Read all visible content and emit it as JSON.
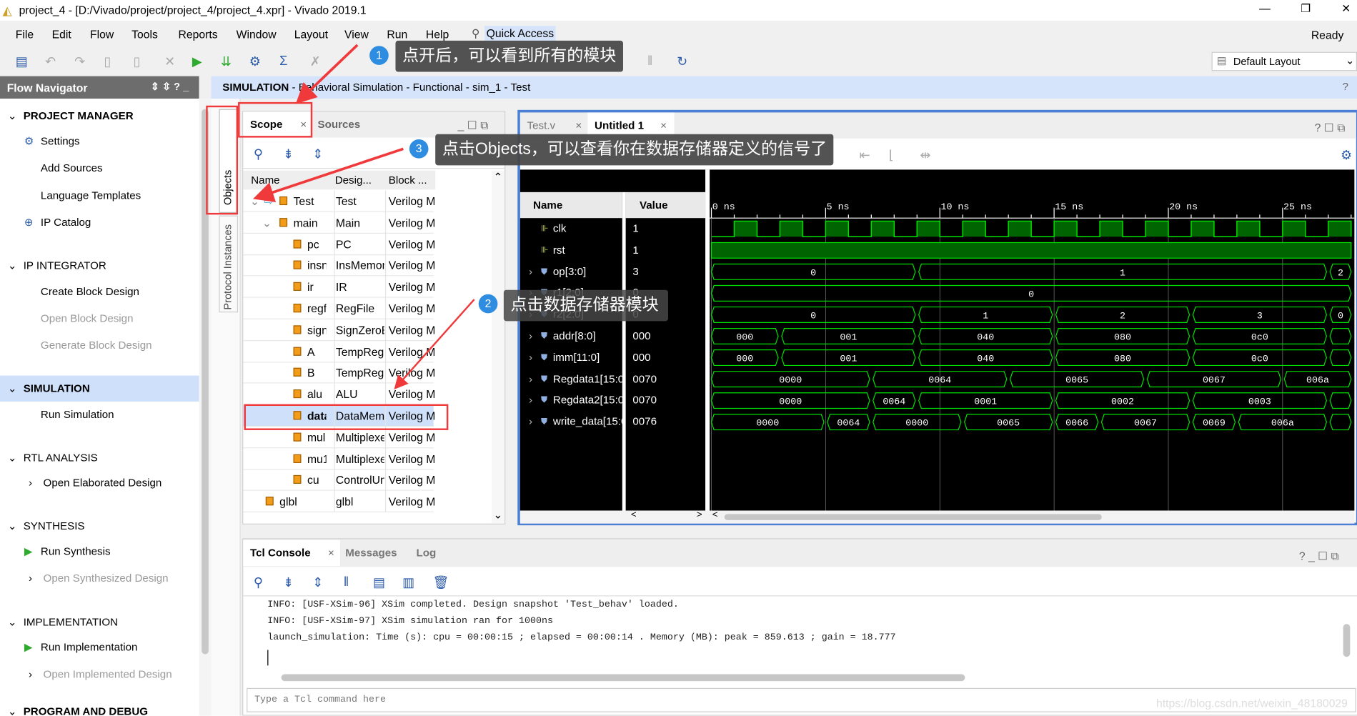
{
  "window": {
    "title": "project_4 - [D:/Vivado/project/project_4/project_4.xpr] - Vivado 2019.1",
    "status": "Ready",
    "controls": [
      "—",
      "❐",
      "✕"
    ]
  },
  "menu": [
    "File",
    "Edit",
    "Flow",
    "Tools",
    "Reports",
    "Window",
    "Layout",
    "View",
    "Run",
    "Help"
  ],
  "quick_access": "Quick Access",
  "layout_select": "Default Layout",
  "flow_navigator": {
    "title": "Flow Navigator",
    "items": [
      {
        "label": "PROJECT MANAGER",
        "type": "section",
        "bold": true
      },
      {
        "label": "Settings",
        "icon": "gear-icon"
      },
      {
        "label": "Add Sources"
      },
      {
        "label": "Language Templates"
      },
      {
        "label": "IP Catalog",
        "icon": "ip-icon"
      },
      {
        "label": "IP INTEGRATOR",
        "type": "section"
      },
      {
        "label": "Create Block Design"
      },
      {
        "label": "Open Block Design",
        "disabled": true
      },
      {
        "label": "Generate Block Design",
        "disabled": true
      },
      {
        "label": "SIMULATION",
        "type": "section",
        "bold": true,
        "selected": true
      },
      {
        "label": "Run Simulation"
      },
      {
        "label": "RTL ANALYSIS",
        "type": "section"
      },
      {
        "label": "Open Elaborated Design",
        "expand": true
      },
      {
        "label": "SYNTHESIS",
        "type": "section"
      },
      {
        "label": "Run Synthesis",
        "icon": "run-icon"
      },
      {
        "label": "Open Synthesized Design",
        "expand": true,
        "disabled": true
      },
      {
        "label": "IMPLEMENTATION",
        "type": "section"
      },
      {
        "label": "Run Implementation",
        "icon": "run-icon"
      },
      {
        "label": "Open Implemented Design",
        "expand": true,
        "disabled": true
      },
      {
        "label": "PROGRAM AND DEBUG",
        "type": "section",
        "bold": true
      }
    ]
  },
  "side_tabs": [
    "Objects",
    "Protocol Instances"
  ],
  "sim_header": {
    "bold": "SIMULATION",
    "rest": " - Behavioral Simulation - Functional - sim_1 - Test"
  },
  "scope": {
    "tabs": [
      "Scope",
      "Sources"
    ],
    "columns": [
      "Name",
      "Desig...",
      "Block ..."
    ],
    "rows": [
      {
        "name": "Test",
        "design": "Test",
        "block": "Verilog Mc",
        "level": 0,
        "expanded": true,
        "top": true
      },
      {
        "name": "main",
        "design": "Main",
        "block": "Verilog Mc",
        "level": 1,
        "expanded": true
      },
      {
        "name": "pc",
        "design": "PC",
        "block": "Verilog Mc",
        "level": 2
      },
      {
        "name": "insn",
        "design": "InsMemory",
        "block": "Verilog Mc",
        "level": 2
      },
      {
        "name": "ir",
        "design": "IR",
        "block": "Verilog Mc",
        "level": 2
      },
      {
        "name": "regfile",
        "design": "RegFile",
        "block": "Verilog Mc",
        "level": 2
      },
      {
        "name": "sign",
        "design": "SignZeroExtend",
        "block": "Verilog Mc",
        "level": 2
      },
      {
        "name": "A",
        "design": "TempReg",
        "block": "Verilog Mc",
        "level": 2
      },
      {
        "name": "B",
        "design": "TempReg",
        "block": "Verilog Mc",
        "level": 2
      },
      {
        "name": "alu",
        "design": "ALU",
        "block": "Verilog Mc",
        "level": 2
      },
      {
        "name": "data",
        "design": "DataMemory",
        "block": "Verilog Mc",
        "level": 2,
        "selected": true
      },
      {
        "name": "mul",
        "design": "Multiplexer",
        "block": "Verilog Mc",
        "level": 2
      },
      {
        "name": "mu1",
        "design": "Multiplexer",
        "block": "Verilog Mc",
        "level": 2
      },
      {
        "name": "cu",
        "design": "ControlUnit",
        "block": "Verilog Mc",
        "level": 2
      },
      {
        "name": "glbl",
        "design": "glbl",
        "block": "Verilog Mc",
        "level": 0
      }
    ]
  },
  "wave": {
    "tabs": [
      "Test.v",
      "Untitled 1"
    ],
    "columns": [
      "Name",
      "Value"
    ],
    "time_unit": "ns",
    "ticks": [
      0,
      5,
      10,
      15,
      20,
      25
    ],
    "view_range_ns": [
      0,
      28
    ],
    "signals": [
      {
        "name": "clk",
        "value": "1",
        "type": "bit",
        "clock": {
          "period": 2,
          "high_offset": 1
        }
      },
      {
        "name": "rst",
        "value": "1",
        "type": "bit",
        "level": 1
      },
      {
        "name": "op[3:0]",
        "value": "3",
        "type": "bus",
        "segs": [
          [
            0,
            9,
            "0"
          ],
          [
            9,
            27,
            "1"
          ],
          [
            27,
            28,
            "2"
          ]
        ]
      },
      {
        "name": "r1[2:0]",
        "value": "0",
        "type": "bus",
        "segs": [
          [
            0,
            28,
            "0"
          ]
        ]
      },
      {
        "name": "r2[2:0]",
        "value": "0",
        "type": "bus",
        "segs": [
          [
            0,
            9,
            "0"
          ],
          [
            9,
            15,
            "1"
          ],
          [
            15,
            21,
            "2"
          ],
          [
            21,
            27,
            "3"
          ],
          [
            27,
            28,
            "0"
          ]
        ]
      },
      {
        "name": "addr[8:0]",
        "value": "000",
        "type": "bus",
        "segs": [
          [
            0,
            3,
            "000"
          ],
          [
            3,
            9,
            "001"
          ],
          [
            9,
            15,
            "040"
          ],
          [
            15,
            21,
            "080"
          ],
          [
            21,
            27,
            "0c0"
          ],
          [
            27,
            28,
            ""
          ]
        ]
      },
      {
        "name": "imm[11:0]",
        "value": "000",
        "type": "bus",
        "segs": [
          [
            0,
            3,
            "000"
          ],
          [
            3,
            9,
            "001"
          ],
          [
            9,
            15,
            "040"
          ],
          [
            15,
            21,
            "080"
          ],
          [
            21,
            27,
            "0c0"
          ],
          [
            27,
            28,
            ""
          ]
        ]
      },
      {
        "name": "Regdata1[15:0]",
        "value": "0070",
        "type": "bus",
        "segs": [
          [
            0,
            7,
            "0000"
          ],
          [
            7,
            13,
            "0064"
          ],
          [
            13,
            19,
            "0065"
          ],
          [
            19,
            25,
            "0067"
          ],
          [
            25,
            28,
            "006a"
          ]
        ]
      },
      {
        "name": "Regdata2[15:0]",
        "value": "0070",
        "type": "bus",
        "segs": [
          [
            0,
            7,
            "0000"
          ],
          [
            7,
            9,
            "0064"
          ],
          [
            9,
            15,
            "0001"
          ],
          [
            15,
            21,
            "0002"
          ],
          [
            21,
            27,
            "0003"
          ],
          [
            27,
            28,
            ""
          ]
        ]
      },
      {
        "name": "write_data[15:0]",
        "value": "0076",
        "type": "bus",
        "segs": [
          [
            0,
            5,
            "0000"
          ],
          [
            5,
            7,
            "0064"
          ],
          [
            7,
            11,
            "0000"
          ],
          [
            11,
            15,
            "0065"
          ],
          [
            15,
            17,
            "0066"
          ],
          [
            17,
            21,
            "0067"
          ],
          [
            21,
            23,
            "0069"
          ],
          [
            23,
            27,
            "006a"
          ],
          [
            27,
            28,
            ""
          ]
        ]
      }
    ],
    "color": "#00e000"
  },
  "console": {
    "tabs": [
      "Tcl Console",
      "Messages",
      "Log"
    ],
    "lines": [
      "INFO: [USF-XSim-96] XSim completed. Design snapshot 'Test_behav' loaded.",
      "INFO: [USF-XSim-97] XSim simulation ran for 1000ns",
      "launch_simulation: Time (s): cpu = 00:00:15 ; elapsed = 00:00:14 . Memory (MB): peak = 859.613 ; gain = 18.777"
    ],
    "placeholder": "Type a Tcl command here"
  },
  "watermark": "https://blog.csdn.net/weixin_48180029",
  "annotations": [
    {
      "n": "1",
      "text": "点开后，可以看到所有的模块"
    },
    {
      "n": "2",
      "text": "点击数据存储器模块"
    },
    {
      "n": "3",
      "text": "点击Objects，可以查看你在数据存储器定义的信号了"
    }
  ],
  "colors": {
    "accent": "#2e8de0",
    "highlight": "#f0393b",
    "selection": "#cfe0fb",
    "wave": "#00e000"
  }
}
